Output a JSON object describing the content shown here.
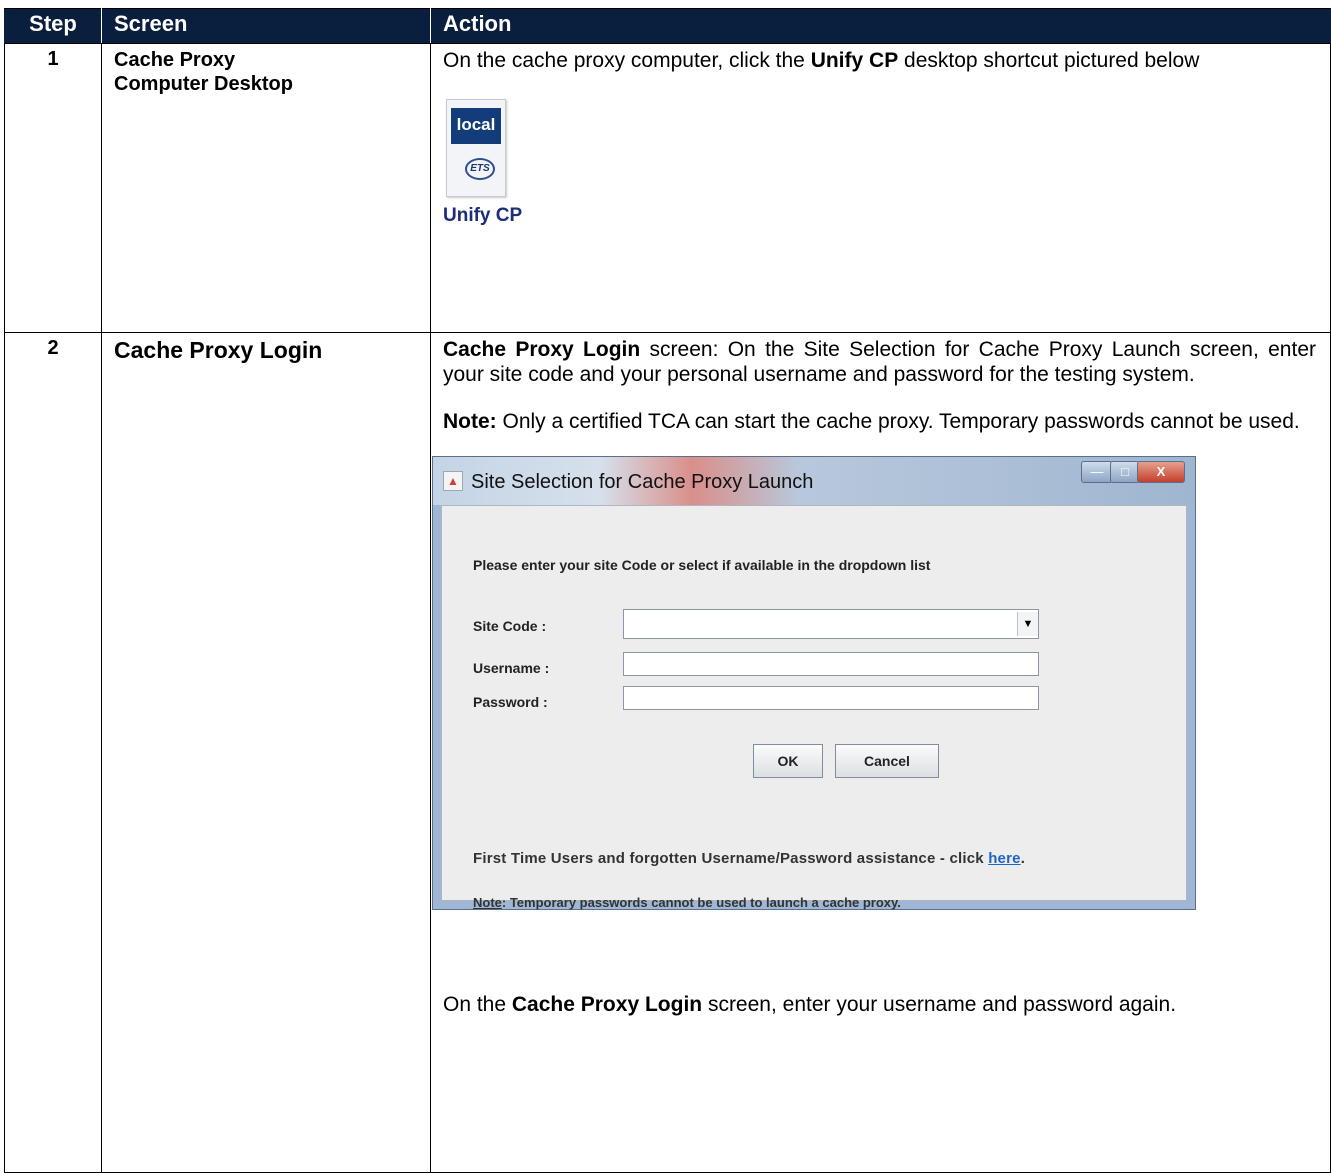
{
  "header": {
    "step": "Step",
    "screen": "Screen",
    "action": "Action"
  },
  "row1": {
    "step": "1",
    "screen_line1": "Cache Proxy",
    "screen_line2": "Computer Desktop",
    "action_pre": "On the cache proxy computer, click the ",
    "action_bold": "Unify CP",
    "action_post": " desktop shortcut pictured below",
    "shortcut": {
      "band_text": "local",
      "logo_text": "ETS",
      "label": "Unify CP",
      "icon": "unify-cp-desktop-icon"
    }
  },
  "row2": {
    "step": "2",
    "screen": "Cache Proxy Login",
    "para1_bold": "Cache Proxy Login",
    "para1_rest": " screen: On the Site Selection for Cache Proxy Launch screen, enter your site code and your personal username and password for the testing system.",
    "note_bold": "Note:",
    "note_rest": " Only a certified TCA can start the cache proxy. Temporary passwords cannot be used.",
    "dialog": {
      "title": "Site Selection for Cache Proxy Launch",
      "prompt": "Please enter your site Code or select if available in the dropdown list",
      "site_code_label": "Site Code :",
      "site_code_value": "",
      "username_label": "Username :",
      "username_value": "",
      "password_label": "Password :",
      "password_value": "",
      "ok_label": "OK",
      "cancel_label": "Cancel",
      "help_text": "First Time Users and forgotten Username/Password assistance - click ",
      "help_link": "here",
      "help_end": ".",
      "note_label": "Note",
      "note_text": ": Temporary passwords cannot be used to launch a cache proxy.",
      "close_glyph": "X"
    },
    "final_pre": "On the ",
    "final_bold": "Cache Proxy Login",
    "final_post": " screen, enter your username and password again."
  }
}
